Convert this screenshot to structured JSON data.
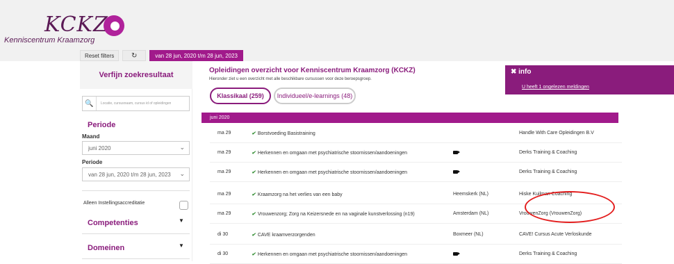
{
  "header": {
    "logo_text": "KCKZ",
    "logo_sub": "Kenniscentrum Kraamzorg",
    "reset_label": "Reset filters",
    "refresh_icon": "↻",
    "date_range": "van 28 jun, 2020 t/m 28 jun, 2023"
  },
  "sidebar": {
    "title": "Verfijn zoekresultaat",
    "search_placeholder": "Locatie, cursusnaam, cursus id of opleidingen",
    "periode_heading": "Periode",
    "maand_label": "Maand",
    "maand_value": "juni 2020",
    "periode_label": "Periode",
    "periode_value": "van 28 jun, 2020 t/m 28 jun, 2023",
    "accreditatie_label": "Alleen Instellingsaccreditatie",
    "competenties": "Competenties",
    "domeinen": "Domeinen"
  },
  "main": {
    "title": "Opleidingen overzicht voor Kenniscentrum Kraamzorg (KCKZ)",
    "subtitle": "Hieronder ziet u een overzicht met alle beschikbare cursussen voor deze beroepsgroep.",
    "tab_klassikaal": "Klassikaal (259)",
    "tab_individueel": "Individueel/e-learnings (48)",
    "month": "juni 2020",
    "rows": [
      {
        "date": "ma 29",
        "title": "Borstvoeding Basistraining",
        "location": "",
        "online": false,
        "org": "Handle With Care Opleidingen B.V"
      },
      {
        "date": "ma 29",
        "title": "Herkennen en omgaan met psychiatrische stoornissen/aandoeningen",
        "location": "",
        "online": true,
        "org": "Derks Training & Coaching"
      },
      {
        "date": "ma 29",
        "title": "Herkennen en omgaan met psychiatrische stoornissen/aandoeningen",
        "location": "",
        "online": true,
        "org": "Derks Training & Coaching"
      },
      {
        "date": "ma 29",
        "title": "Kraamzorg na het verlies van een baby",
        "location": "Heemskerk (NL)",
        "online": false,
        "org": "Hiske Kuilman Coaching"
      },
      {
        "date": "ma 29",
        "title": "Vrouwenzorg; Zorg na Keizersnede en na vaginale kunstverlossing (n19)",
        "location": "Amsterdam (NL)",
        "online": false,
        "org": "VrouwenZorg (VrouwenZorg)"
      },
      {
        "date": "di 30",
        "title": "CAVE kraamverzorgenden",
        "location": "Boxmeer (NL)",
        "online": false,
        "org": "CAVE! Cursus Acute Verloskunde"
      },
      {
        "date": "di 30",
        "title": "Herkennen en omgaan met psychiatrische stoornissen/aandoeningen",
        "location": "",
        "online": true,
        "org": "Derks Training & Coaching"
      }
    ]
  },
  "info": {
    "heading": "✖ info",
    "link": "U heeft 1 ongelezen meldingen"
  },
  "colors": {
    "brand": "#8a1c7c",
    "accent": "#a11a8b",
    "highlight": "#e31d1d"
  }
}
